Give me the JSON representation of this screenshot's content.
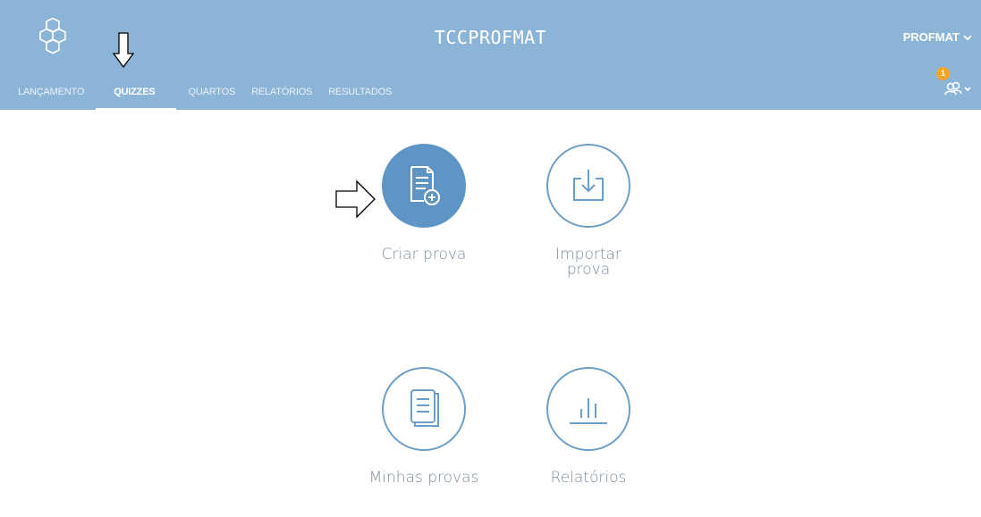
{
  "header": {
    "title": "TCCPROFMAT",
    "user_label": "PROFMAT",
    "notification_count": "1",
    "background": "#8cb4d6"
  },
  "nav": {
    "items": [
      {
        "label": "LANÇAMENTO"
      },
      {
        "label": "QUIZZES"
      },
      {
        "label": "QUARTOS"
      },
      {
        "label": "RELATÓRIOS"
      },
      {
        "label": "RESULTADOS"
      }
    ],
    "active": "QUIZZES"
  },
  "tiles": [
    {
      "label": "Criar prova",
      "icon": "document-add-icon"
    },
    {
      "label": "Importar\nprova",
      "icon": "import-icon"
    },
    {
      "label": "Minhas provas",
      "icon": "documents-icon"
    },
    {
      "label": "Relatórios",
      "icon": "bar-chart-icon"
    }
  ],
  "colors": {
    "accent": "#5e95c4",
    "tile_label": "#7b8c9d",
    "badge": "#f4a523"
  }
}
